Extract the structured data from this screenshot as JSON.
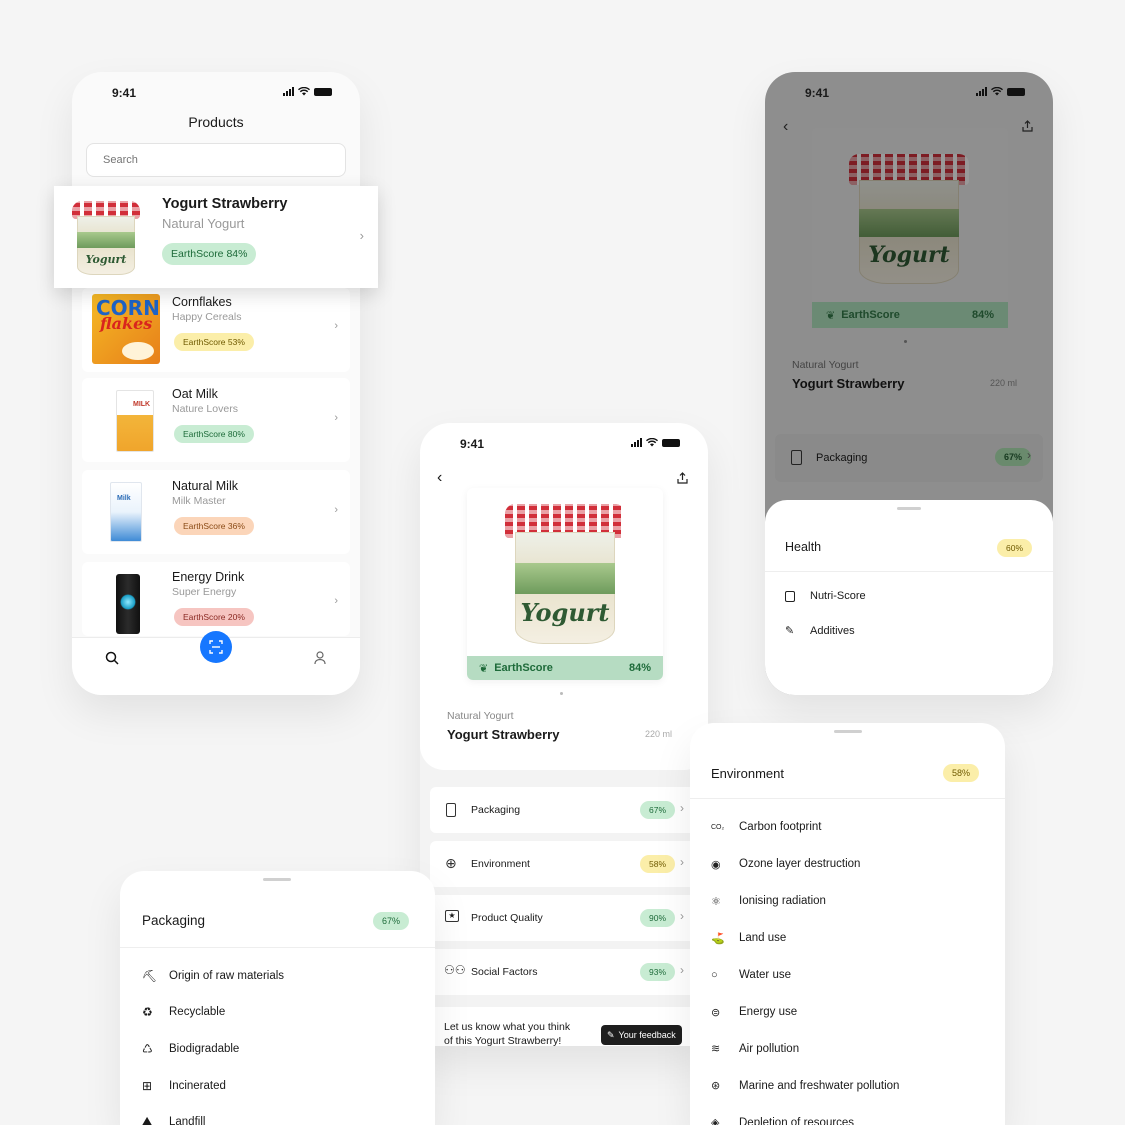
{
  "status_time": "9:41",
  "products_screen": {
    "title": "Products",
    "search_placeholder": "Search",
    "items": [
      {
        "name": "Yogurt Strawberry",
        "brand": "Natural Yogurt",
        "score": "EarthScore 84%",
        "color": "green"
      },
      {
        "name": "Cornflakes",
        "brand": "Happy Cereals",
        "score": "EarthScore 53%",
        "color": "yellow"
      },
      {
        "name": "Oat Milk",
        "brand": "Nature Lovers",
        "score": "EarthScore 80%",
        "color": "green"
      },
      {
        "name": "Natural Milk",
        "brand": "Milk Master",
        "score": "EarthScore 36%",
        "color": "orange"
      },
      {
        "name": "Energy Drink",
        "brand": "Super Energy",
        "score": "EarthScore 20%",
        "color": "red"
      }
    ],
    "nav_icons": [
      "search-icon",
      "scan-icon",
      "profile-icon"
    ]
  },
  "detail_screen": {
    "badge_label": "EarthScore",
    "badge_value": "84%",
    "brand": "Natural Yogurt",
    "name": "Yogurt Strawberry",
    "volume": "220 ml",
    "categories": [
      {
        "label": "Packaging",
        "value": "67%",
        "color": "green",
        "icon": "package-icon"
      },
      {
        "label": "Environment",
        "value": "58%",
        "color": "yellow",
        "icon": "globe-icon"
      },
      {
        "label": "Product Quality",
        "value": "90%",
        "color": "green",
        "icon": "quality-icon"
      },
      {
        "label": "Social Factors",
        "value": "93%",
        "color": "green",
        "icon": "people-icon"
      }
    ],
    "feedback_text_1": "Let us know what you think",
    "feedback_text_2": "of this Yogurt Strawberry!",
    "feedback_button": "Your feedback"
  },
  "health_screen": {
    "badge_label": "EarthScore",
    "badge_value": "84%",
    "brand": "Natural Yogurt",
    "name": "Yogurt Strawberry",
    "volume": "220 ml",
    "packaging_label": "Packaging",
    "packaging_value": "67%",
    "sheet_title": "Health",
    "sheet_value": "60%",
    "items": [
      {
        "label": "Nutri-Score",
        "icon": "nutri-icon"
      },
      {
        "label": "Additives",
        "icon": "pipette-icon"
      }
    ]
  },
  "packaging_sheet": {
    "title": "Packaging",
    "value": "67%",
    "items": [
      {
        "label": "Origin of raw materials",
        "icon": "pickaxe-icon"
      },
      {
        "label": "Recyclable",
        "icon": "recycle-icon"
      },
      {
        "label": "Biodigradable",
        "icon": "leaf-recycle-icon"
      },
      {
        "label": "Incinerated",
        "icon": "incinerator-icon"
      },
      {
        "label": "Landfill",
        "icon": "landfill-icon"
      }
    ]
  },
  "environment_sheet": {
    "title": "Environment",
    "value": "58%",
    "items": [
      {
        "label": "Carbon footprint",
        "glyph": "CO₂",
        "icon": "co2-icon"
      },
      {
        "label": "Ozone layer destruction",
        "glyph": "◉",
        "icon": "ozone-icon"
      },
      {
        "label": "Ionising radiation",
        "glyph": "⚛",
        "icon": "radiation-icon"
      },
      {
        "label": "Land use",
        "glyph": "⛳",
        "icon": "land-icon"
      },
      {
        "label": "Water use",
        "glyph": "○",
        "icon": "water-drop-icon"
      },
      {
        "label": "Energy use",
        "glyph": "⊜",
        "icon": "energy-icon"
      },
      {
        "label": "Air pollution",
        "glyph": "≋",
        "icon": "wind-icon"
      },
      {
        "label": "Marine and freshwater pollution",
        "glyph": "⊛",
        "icon": "marine-icon"
      },
      {
        "label": "Depletion of resources",
        "glyph": "◈",
        "icon": "depletion-icon"
      }
    ]
  },
  "cup_word": "Yogurt",
  "colors": {
    "accent": "#1677ff",
    "green_pill": "#c8ecd3",
    "yellow_pill": "#fbeea9",
    "earth_badge": "#b6dcc2"
  }
}
